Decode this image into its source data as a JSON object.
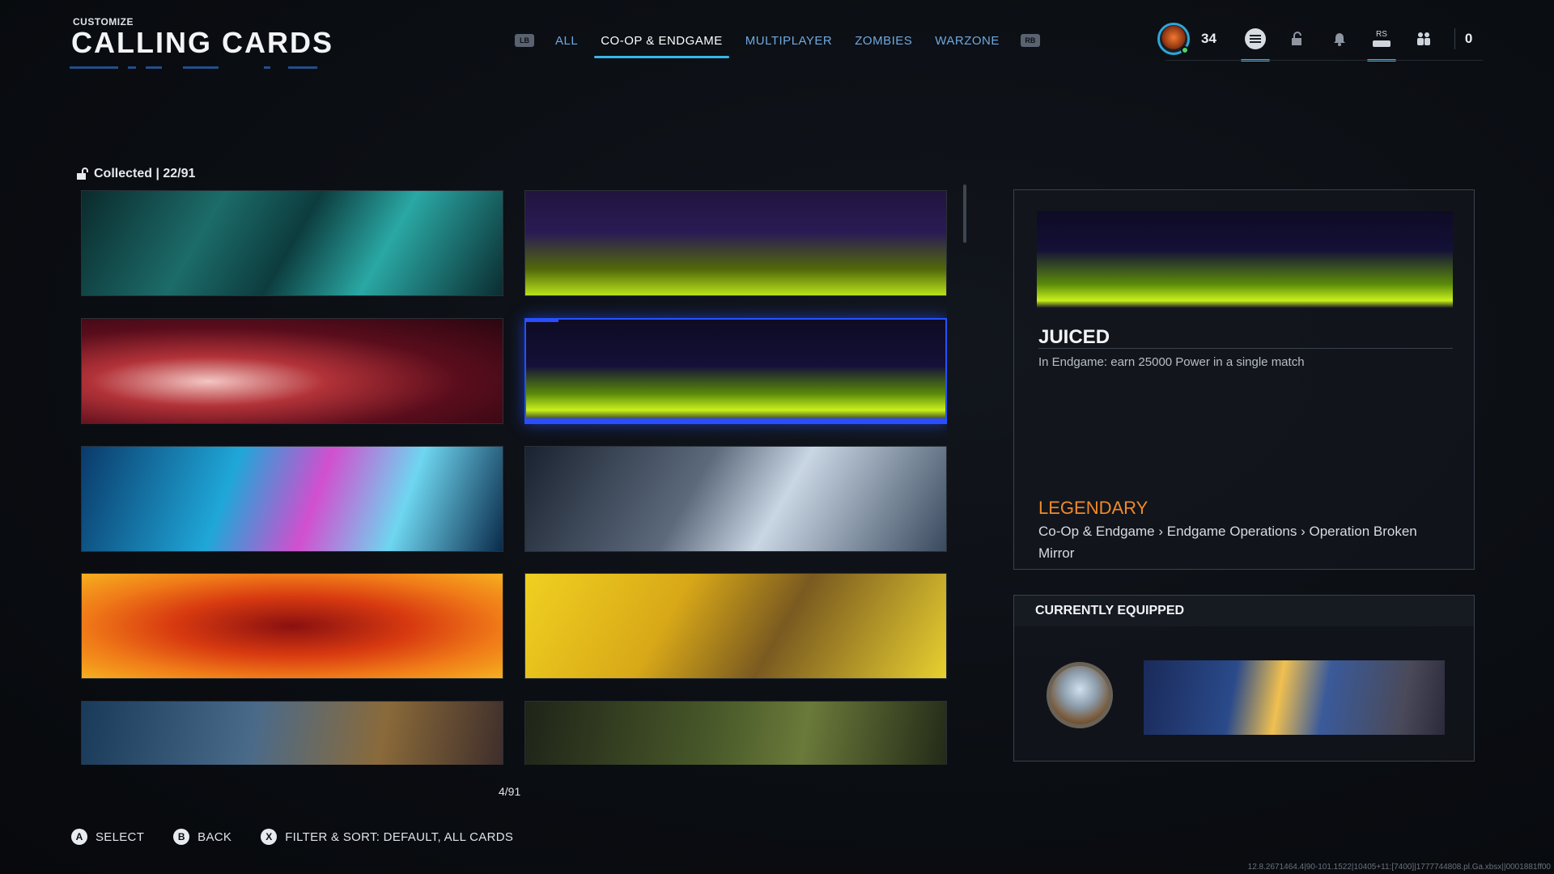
{
  "header": {
    "subtitle": "CUSTOMIZE",
    "title": "CALLING CARDS"
  },
  "tabs": {
    "lb": "LB",
    "rb": "RB",
    "items": [
      {
        "label": "ALL",
        "active": false
      },
      {
        "label": "CO-OP & ENDGAME",
        "active": true
      },
      {
        "label": "MULTIPLAYER",
        "active": false
      },
      {
        "label": "ZOMBIES",
        "active": false
      },
      {
        "label": "WARZONE",
        "active": false
      }
    ]
  },
  "topbar": {
    "level": "34",
    "rs_label": "RS",
    "count": "0",
    "icons": [
      "rank-icon",
      "menu-icon",
      "lock-icon",
      "notification-icon",
      "controller-icon",
      "social-icon"
    ]
  },
  "collection": {
    "label": "Collected | 22/91",
    "page_indicator": "4/91",
    "selected_index": 3
  },
  "cards": [
    {
      "theme": "mech-cyan"
    },
    {
      "theme": "skeleton-bird-neon"
    },
    {
      "theme": "anime-eyes-red"
    },
    {
      "theme": "juiced-skeleton-hand"
    },
    {
      "theme": "binary-goat"
    },
    {
      "theme": "space-shatter"
    },
    {
      "theme": "fire-soldier"
    },
    {
      "theme": "wingsuit-yellow"
    },
    {
      "theme": "stadium-soldier"
    },
    {
      "theme": "crocodile"
    }
  ],
  "detail": {
    "name": "JUICED",
    "description": "In Endgame: earn 25000 Power in a single match",
    "rarity": "LEGENDARY",
    "path": "Co-Op & Endgame › Endgame Operations › Operation Broken Mirror"
  },
  "equipped": {
    "title": "CURRENTLY EQUIPPED"
  },
  "footer": {
    "prompts": [
      {
        "button": "A",
        "label": "SELECT"
      },
      {
        "button": "B",
        "label": "BACK"
      },
      {
        "button": "X",
        "label": "FILTER & SORT: DEFAULT, ALL CARDS"
      }
    ],
    "build_info": "12.8.2671464.4|90-101.1522|10405+11:[7400]|1777744808.pl.Ga.xbsx||0001881ff00"
  },
  "colors": {
    "accent": "#38b6e8",
    "selection": "#2452ff",
    "legendary": "#f08a2a"
  }
}
